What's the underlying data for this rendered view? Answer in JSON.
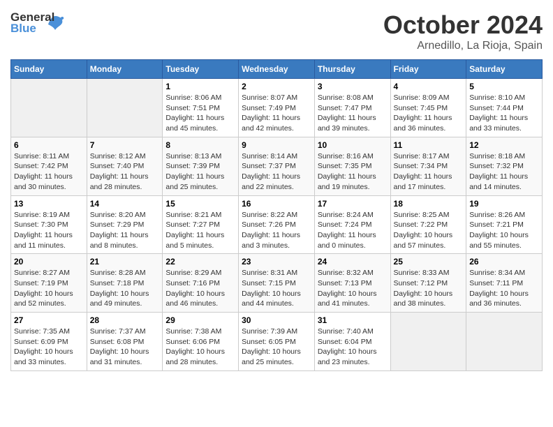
{
  "logo": {
    "general": "General",
    "blue": "Blue"
  },
  "title": "October 2024",
  "location": "Arnedillo, La Rioja, Spain",
  "days_of_week": [
    "Sunday",
    "Monday",
    "Tuesday",
    "Wednesday",
    "Thursday",
    "Friday",
    "Saturday"
  ],
  "weeks": [
    [
      {
        "day": "",
        "empty": true
      },
      {
        "day": "",
        "empty": true
      },
      {
        "day": "1",
        "sunrise": "Sunrise: 8:06 AM",
        "sunset": "Sunset: 7:51 PM",
        "daylight": "Daylight: 11 hours and 45 minutes."
      },
      {
        "day": "2",
        "sunrise": "Sunrise: 8:07 AM",
        "sunset": "Sunset: 7:49 PM",
        "daylight": "Daylight: 11 hours and 42 minutes."
      },
      {
        "day": "3",
        "sunrise": "Sunrise: 8:08 AM",
        "sunset": "Sunset: 7:47 PM",
        "daylight": "Daylight: 11 hours and 39 minutes."
      },
      {
        "day": "4",
        "sunrise": "Sunrise: 8:09 AM",
        "sunset": "Sunset: 7:45 PM",
        "daylight": "Daylight: 11 hours and 36 minutes."
      },
      {
        "day": "5",
        "sunrise": "Sunrise: 8:10 AM",
        "sunset": "Sunset: 7:44 PM",
        "daylight": "Daylight: 11 hours and 33 minutes."
      }
    ],
    [
      {
        "day": "6",
        "sunrise": "Sunrise: 8:11 AM",
        "sunset": "Sunset: 7:42 PM",
        "daylight": "Daylight: 11 hours and 30 minutes."
      },
      {
        "day": "7",
        "sunrise": "Sunrise: 8:12 AM",
        "sunset": "Sunset: 7:40 PM",
        "daylight": "Daylight: 11 hours and 28 minutes."
      },
      {
        "day": "8",
        "sunrise": "Sunrise: 8:13 AM",
        "sunset": "Sunset: 7:39 PM",
        "daylight": "Daylight: 11 hours and 25 minutes."
      },
      {
        "day": "9",
        "sunrise": "Sunrise: 8:14 AM",
        "sunset": "Sunset: 7:37 PM",
        "daylight": "Daylight: 11 hours and 22 minutes."
      },
      {
        "day": "10",
        "sunrise": "Sunrise: 8:16 AM",
        "sunset": "Sunset: 7:35 PM",
        "daylight": "Daylight: 11 hours and 19 minutes."
      },
      {
        "day": "11",
        "sunrise": "Sunrise: 8:17 AM",
        "sunset": "Sunset: 7:34 PM",
        "daylight": "Daylight: 11 hours and 17 minutes."
      },
      {
        "day": "12",
        "sunrise": "Sunrise: 8:18 AM",
        "sunset": "Sunset: 7:32 PM",
        "daylight": "Daylight: 11 hours and 14 minutes."
      }
    ],
    [
      {
        "day": "13",
        "sunrise": "Sunrise: 8:19 AM",
        "sunset": "Sunset: 7:30 PM",
        "daylight": "Daylight: 11 hours and 11 minutes."
      },
      {
        "day": "14",
        "sunrise": "Sunrise: 8:20 AM",
        "sunset": "Sunset: 7:29 PM",
        "daylight": "Daylight: 11 hours and 8 minutes."
      },
      {
        "day": "15",
        "sunrise": "Sunrise: 8:21 AM",
        "sunset": "Sunset: 7:27 PM",
        "daylight": "Daylight: 11 hours and 5 minutes."
      },
      {
        "day": "16",
        "sunrise": "Sunrise: 8:22 AM",
        "sunset": "Sunset: 7:26 PM",
        "daylight": "Daylight: 11 hours and 3 minutes."
      },
      {
        "day": "17",
        "sunrise": "Sunrise: 8:24 AM",
        "sunset": "Sunset: 7:24 PM",
        "daylight": "Daylight: 11 hours and 0 minutes."
      },
      {
        "day": "18",
        "sunrise": "Sunrise: 8:25 AM",
        "sunset": "Sunset: 7:22 PM",
        "daylight": "Daylight: 10 hours and 57 minutes."
      },
      {
        "day": "19",
        "sunrise": "Sunrise: 8:26 AM",
        "sunset": "Sunset: 7:21 PM",
        "daylight": "Daylight: 10 hours and 55 minutes."
      }
    ],
    [
      {
        "day": "20",
        "sunrise": "Sunrise: 8:27 AM",
        "sunset": "Sunset: 7:19 PM",
        "daylight": "Daylight: 10 hours and 52 minutes."
      },
      {
        "day": "21",
        "sunrise": "Sunrise: 8:28 AM",
        "sunset": "Sunset: 7:18 PM",
        "daylight": "Daylight: 10 hours and 49 minutes."
      },
      {
        "day": "22",
        "sunrise": "Sunrise: 8:29 AM",
        "sunset": "Sunset: 7:16 PM",
        "daylight": "Daylight: 10 hours and 46 minutes."
      },
      {
        "day": "23",
        "sunrise": "Sunrise: 8:31 AM",
        "sunset": "Sunset: 7:15 PM",
        "daylight": "Daylight: 10 hours and 44 minutes."
      },
      {
        "day": "24",
        "sunrise": "Sunrise: 8:32 AM",
        "sunset": "Sunset: 7:13 PM",
        "daylight": "Daylight: 10 hours and 41 minutes."
      },
      {
        "day": "25",
        "sunrise": "Sunrise: 8:33 AM",
        "sunset": "Sunset: 7:12 PM",
        "daylight": "Daylight: 10 hours and 38 minutes."
      },
      {
        "day": "26",
        "sunrise": "Sunrise: 8:34 AM",
        "sunset": "Sunset: 7:11 PM",
        "daylight": "Daylight: 10 hours and 36 minutes."
      }
    ],
    [
      {
        "day": "27",
        "sunrise": "Sunrise: 7:35 AM",
        "sunset": "Sunset: 6:09 PM",
        "daylight": "Daylight: 10 hours and 33 minutes."
      },
      {
        "day": "28",
        "sunrise": "Sunrise: 7:37 AM",
        "sunset": "Sunset: 6:08 PM",
        "daylight": "Daylight: 10 hours and 31 minutes."
      },
      {
        "day": "29",
        "sunrise": "Sunrise: 7:38 AM",
        "sunset": "Sunset: 6:06 PM",
        "daylight": "Daylight: 10 hours and 28 minutes."
      },
      {
        "day": "30",
        "sunrise": "Sunrise: 7:39 AM",
        "sunset": "Sunset: 6:05 PM",
        "daylight": "Daylight: 10 hours and 25 minutes."
      },
      {
        "day": "31",
        "sunrise": "Sunrise: 7:40 AM",
        "sunset": "Sunset: 6:04 PM",
        "daylight": "Daylight: 10 hours and 23 minutes."
      },
      {
        "day": "",
        "empty": true
      },
      {
        "day": "",
        "empty": true
      }
    ]
  ]
}
